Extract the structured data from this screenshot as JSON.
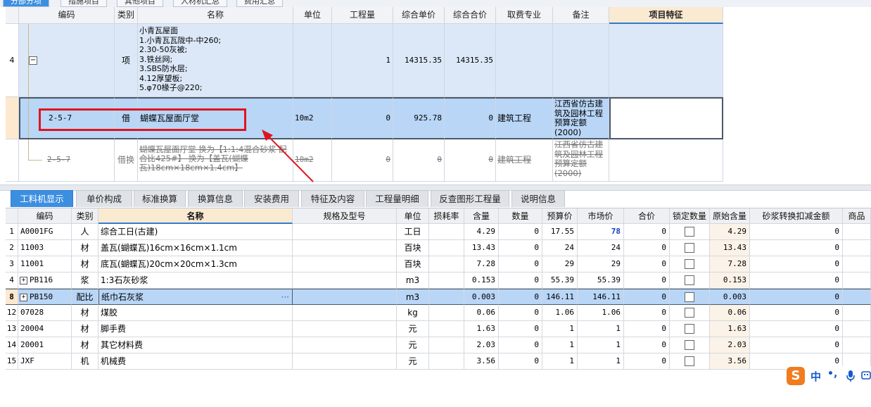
{
  "top_tabs": [
    "分部分项",
    "措施项目",
    "其他项目",
    "人材机汇总",
    "费用汇总"
  ],
  "upper_grid": {
    "headers": {
      "code": "编码",
      "type": "类别",
      "name": "名称",
      "unit": "单位",
      "qty": "工程量",
      "unit_price": "综合单价",
      "total": "综合合价",
      "discipline": "取费专业",
      "remark": "备注",
      "feature": "项目特征"
    },
    "rows": [
      {
        "row_no": "4",
        "code": "",
        "type": "项",
        "name": "小青瓦屋面\n1.小青瓦瓦陇中-中260;\n2.30-50灰被;\n3.铁丝网;\n3.SBS防水层;\n4.12厚望板;\n5.φ70椽子@220;",
        "unit": "",
        "qty": "1",
        "unit_price": "14315.35",
        "total": "14315.35",
        "discipline": "",
        "remark": "",
        "feature": ""
      },
      {
        "row_no": "",
        "code": "2-5-7",
        "type": "借",
        "name": "蝴蝶瓦屋面厅堂",
        "unit": "10m2",
        "qty": "0",
        "unit_price": "925.78",
        "total": "0",
        "discipline": "建筑工程",
        "remark": "江西省仿古建筑及园林工程预算定额(2000)",
        "feature": ""
      },
      {
        "row_no": "",
        "code": "2-5-7",
        "type": "借换",
        "name": "蝴蝶瓦屋面厅堂 换为【1:1:4混合砂浆 配合比425#】 换为【盖瓦(蝴蝶瓦)18cm×18cm×1.4cm】",
        "unit": "10m2",
        "qty": "0",
        "unit_price": "0",
        "total": "0",
        "discipline": "建筑工程",
        "remark": "江西省仿古建筑及园林工程预算定额(2000)",
        "feature": ""
      }
    ]
  },
  "bottom_tabs": [
    "工料机显示",
    "单价构成",
    "标准换算",
    "换算信息",
    "安装费用",
    "特征及内容",
    "工程量明细",
    "反查图形工程量",
    "说明信息"
  ],
  "lower_grid": {
    "headers": {
      "code": "编码",
      "type": "类别",
      "name": "名称",
      "spec": "规格及型号",
      "unit": "单位",
      "loss": "损耗率",
      "content": "含量",
      "qty": "数量",
      "budget": "预算价",
      "market": "市场价",
      "sum": "合价",
      "lock": "锁定数量",
      "orig": "原始含量",
      "mortar": "砂浆转换扣减金额",
      "extra": "商品"
    },
    "rows": [
      {
        "no": "1",
        "code": "A0001FG",
        "type": "人",
        "name": "综合工日(古建)",
        "unit": "工日",
        "content": "4.29",
        "qty": "0",
        "budget": "17.55",
        "market": "78",
        "sum": "0",
        "orig": "4.29",
        "mortar": "0"
      },
      {
        "no": "2",
        "code": "11003",
        "type": "材",
        "name": "盖瓦(蝴蝶瓦)16cm×16cm×1.1cm",
        "unit": "百块",
        "content": "13.43",
        "qty": "0",
        "budget": "24",
        "market": "24",
        "sum": "0",
        "orig": "13.43",
        "mortar": "0"
      },
      {
        "no": "3",
        "code": "11001",
        "type": "材",
        "name": "底瓦(蝴蝶瓦)20cm×20cm×1.3cm",
        "unit": "百块",
        "content": "7.28",
        "qty": "0",
        "budget": "29",
        "market": "29",
        "sum": "0",
        "orig": "7.28",
        "mortar": "0"
      },
      {
        "no": "4",
        "code": "PB116",
        "type": "浆",
        "name": "1:3石灰砂浆",
        "unit": "m3",
        "content": "0.153",
        "qty": "0",
        "budget": "55.39",
        "market": "55.39",
        "sum": "0",
        "orig": "0.153",
        "mortar": "0"
      },
      {
        "no": "8",
        "code": "PB150",
        "type": "配比",
        "name": "纸巾石灰浆",
        "unit": "m3",
        "content": "0.003",
        "qty": "0",
        "budget": "146.11",
        "market": "146.11",
        "sum": "0",
        "orig": "0.003",
        "mortar": "0"
      },
      {
        "no": "12",
        "code": "07028",
        "type": "材",
        "name": "煤胶",
        "unit": "kg",
        "content": "0.06",
        "qty": "0",
        "budget": "1.06",
        "market": "1.06",
        "sum": "0",
        "orig": "0.06",
        "mortar": "0"
      },
      {
        "no": "13",
        "code": "20004",
        "type": "材",
        "name": "脚手费",
        "unit": "元",
        "content": "1.63",
        "qty": "0",
        "budget": "1",
        "market": "1",
        "sum": "0",
        "orig": "1.63",
        "mortar": "0"
      },
      {
        "no": "14",
        "code": "20001",
        "type": "材",
        "name": "其它材料费",
        "unit": "元",
        "content": "2.03",
        "qty": "0",
        "budget": "1",
        "market": "1",
        "sum": "0",
        "orig": "2.03",
        "mortar": "0"
      },
      {
        "no": "15",
        "code": "JXF",
        "type": "机",
        "name": "机械费",
        "unit": "元",
        "content": "3.56",
        "qty": "0",
        "budget": "1",
        "market": "1",
        "sum": "0",
        "orig": "3.56",
        "mortar": "0"
      }
    ],
    "ellipsis": "···"
  },
  "ime": {
    "logo": "S",
    "lang": "中",
    "punct": "•,",
    "mic_icon": "microphone-icon",
    "kbd_icon": "keyboard-icon"
  },
  "colors": {
    "selected_row": "#b9d6f7",
    "highlight_box": "#e0141e",
    "accent_tab": "#3c8fe0",
    "market_blue": "#1a3fc0",
    "feature_header": "#fbead2"
  }
}
